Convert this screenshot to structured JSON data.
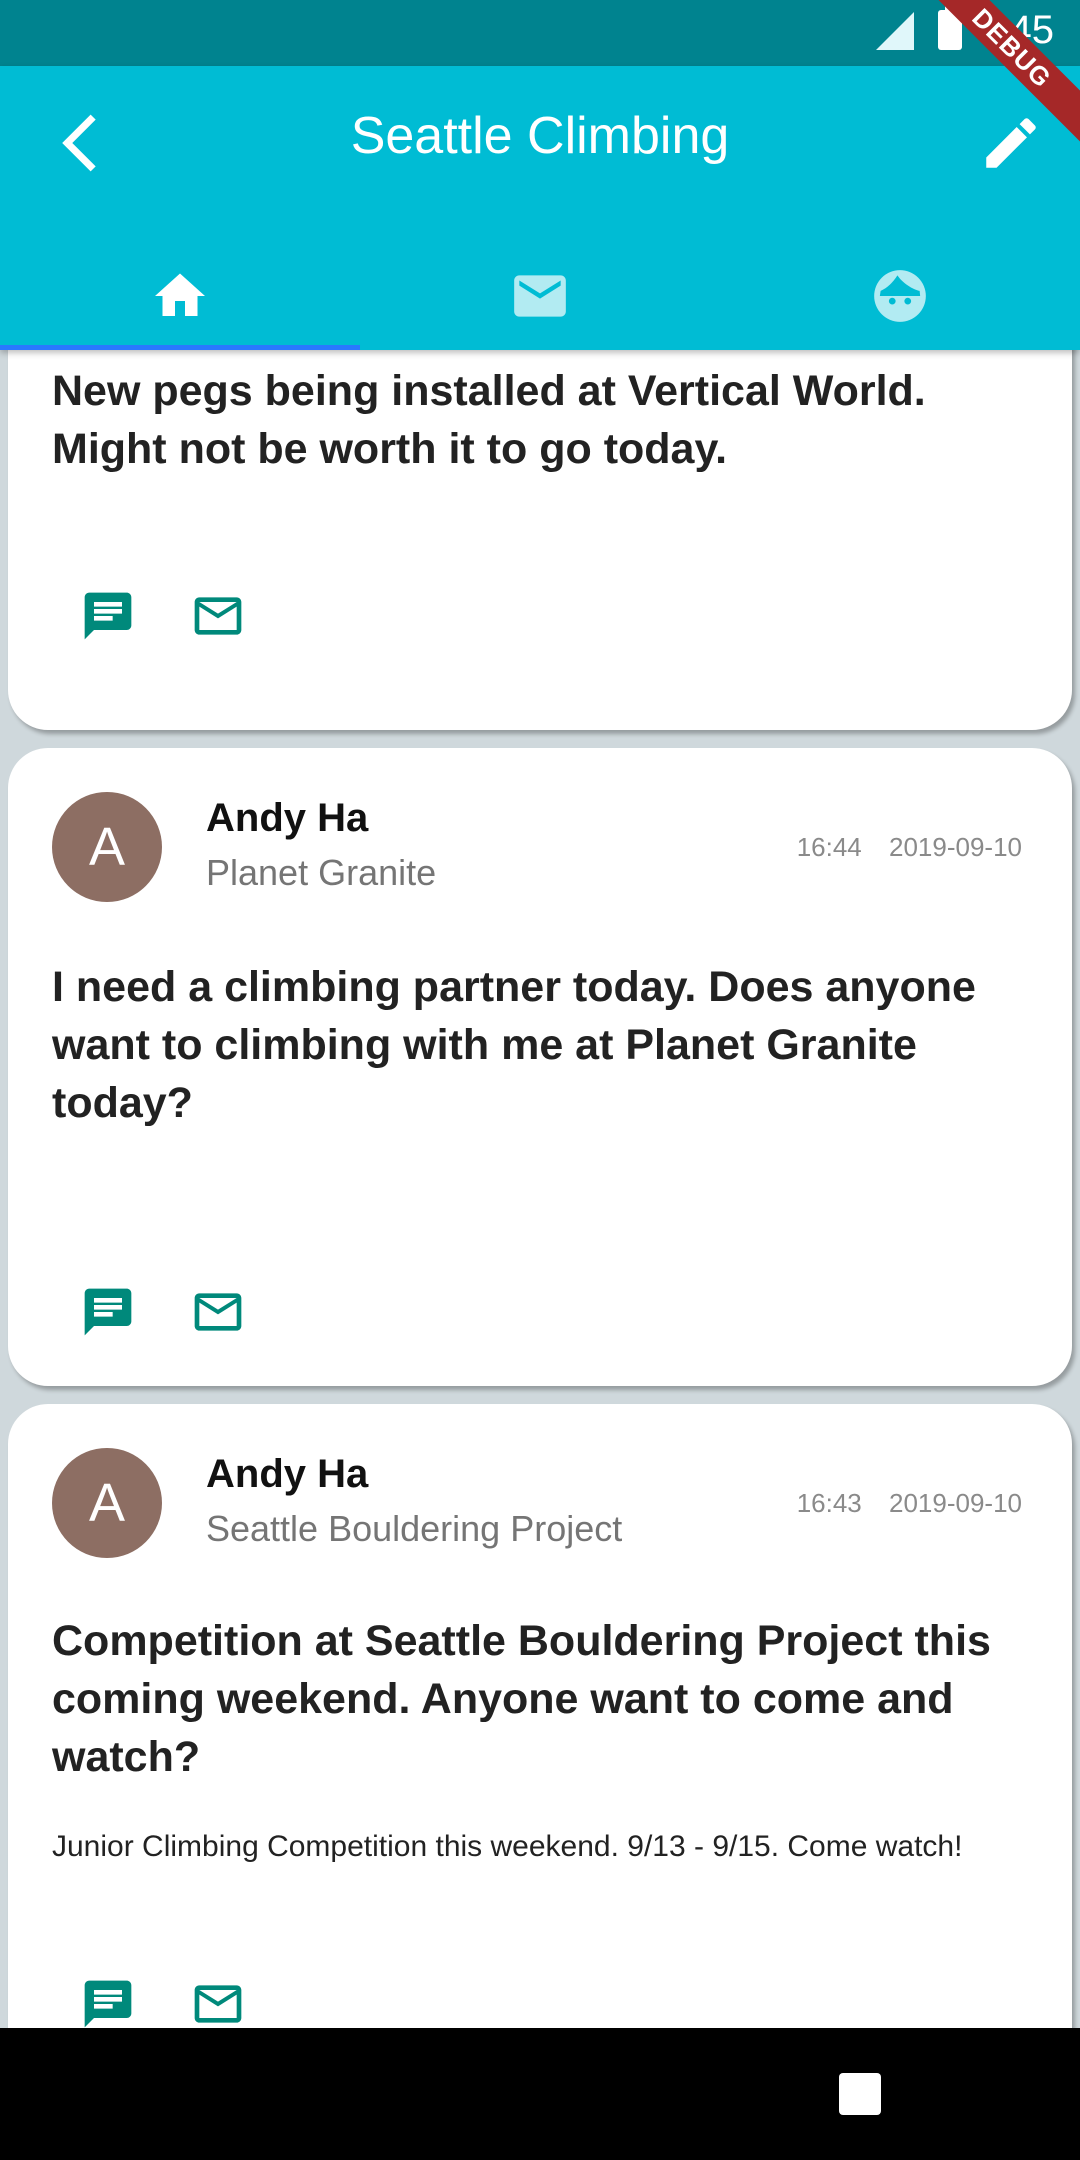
{
  "status_bar": {
    "time": "4:45"
  },
  "debug_banner": "DEBUG",
  "app_bar": {
    "title": "Seattle Climbing"
  },
  "tabs": [
    {
      "icon": "home-icon",
      "selected": true
    },
    {
      "icon": "mail-icon",
      "selected": false
    },
    {
      "icon": "face-icon",
      "selected": false
    }
  ],
  "posts": [
    {
      "title": "New pegs being installed at Vertical World. Might not be worth it to go today."
    },
    {
      "avatar_letter": "A",
      "author": "Andy Ha",
      "location": "Planet Granite",
      "time": "16:44",
      "date": "2019-09-10",
      "title": "I need a climbing partner today. Does anyone want to climbing with me at Planet Granite today?"
    },
    {
      "avatar_letter": "A",
      "author": "Andy Ha",
      "location": "Seattle Bouldering Project",
      "time": "16:43",
      "date": "2019-09-10",
      "title": "Competition at Seattle Bouldering Project this coming weekend. Anyone want to come and watch?",
      "body": "Junior Climbing Competition this weekend. 9/13 - 9/15. Come watch!"
    }
  ],
  "colors": {
    "appbar": "#00bcd4",
    "statusbar": "#00838f",
    "action": "#00897b",
    "avatar": "#8d6e63",
    "tab_indicator": "#2979ff"
  }
}
